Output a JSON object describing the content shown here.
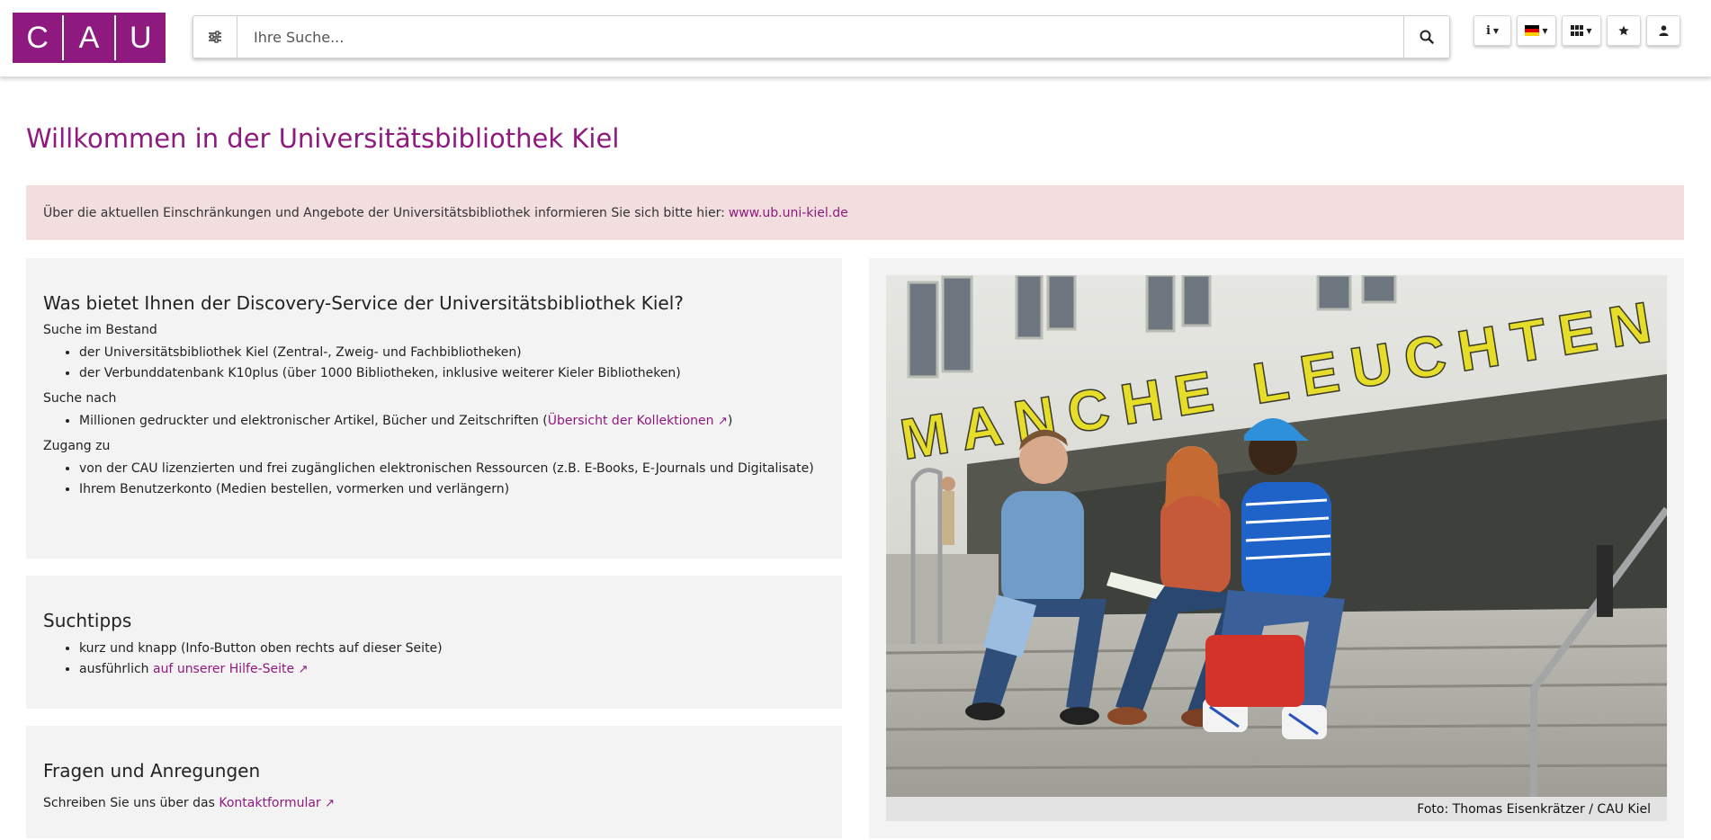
{
  "header": {
    "logo_letters": [
      "C",
      "A",
      "U"
    ],
    "search_placeholder": "Ihre Suche...",
    "toolbar": {
      "info_label": "i",
      "flag_colors": [
        "#000000",
        "#dd0000",
        "#ffce00"
      ]
    }
  },
  "main": {
    "title": "Willkommen in der Universitätsbibliothek Kiel",
    "notice": {
      "text": "Über die aktuellen Einschränkungen und Angebote der Universitätsbibliothek informieren Sie sich bitte hier: ",
      "link": "www.ub.uni-kiel.de"
    },
    "discovery": {
      "heading": "Was bietet Ihnen der Discovery-Service der Universitätsbibliothek Kiel?",
      "sections": [
        {
          "label": "Suche im Bestand",
          "items": [
            "der Universitätsbibliothek Kiel (Zentral-, Zweig- und Fachbibliotheken)",
            "der Verbunddatenbank K10plus (über 1000 Bibliotheken, inklusive weiterer Kieler Bibliotheken)"
          ]
        },
        {
          "label": "Suche nach",
          "item_prefix": "Millionen gedruckter und elektronischer Artikel, Bücher und Zeitschriften (",
          "item_link": "Übersicht der Kollektionen",
          "item_suffix": ")"
        },
        {
          "label": "Zugang zu",
          "items": [
            "von der CAU lizenzierten und frei zugänglichen elektronischen Ressourcen (z.B. E-Books, E-Journals und Digitalisate)",
            "Ihrem Benutzerkonto (Medien bestellen, vormerken und verlängern)"
          ]
        }
      ]
    },
    "tips": {
      "heading": "Suchtipps",
      "item1": "kurz und knapp (Info-Button oben rechts auf dieser Seite)",
      "item2_prefix": "ausführlich ",
      "item2_link": "auf unserer Hilfe-Seite"
    },
    "contact": {
      "heading": "Fragen und Anregungen",
      "text": "Schreiben Sie uns über das ",
      "link": "Kontaktformular"
    },
    "photo": {
      "sign_text": "MANCHE LEUCHTEN",
      "caption": "Foto: Thomas Eisenkrätzer / CAU Kiel"
    }
  },
  "colors": {
    "brand": "#8e1a7f",
    "notice_bg": "#f2dede",
    "panel_bg": "#f3f3f3"
  },
  "icons": [
    "filter-icon",
    "search-icon",
    "info-icon",
    "flag-de-icon",
    "apps-icon",
    "star-icon",
    "user-icon",
    "external-link-icon"
  ]
}
